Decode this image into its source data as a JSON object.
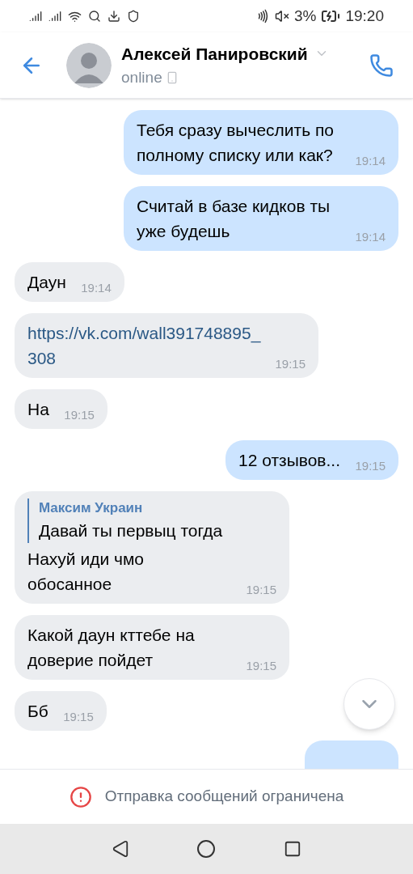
{
  "status_bar": {
    "battery": "3%",
    "time": "19:20"
  },
  "header": {
    "name": "Алексей Панировский",
    "status": "online"
  },
  "messages": [
    {
      "kind": "out",
      "text": "Тебя сразу вычеслить по полному списку или как?",
      "time": "19:14"
    },
    {
      "kind": "out",
      "text": "Считай в базе кидков ты уже будешь",
      "time": "19:14"
    },
    {
      "kind": "in",
      "text": "Даун",
      "time": "19:14"
    },
    {
      "kind": "link",
      "text": "https://vk.com/wall391748895_308",
      "time": "19:15"
    },
    {
      "kind": "in",
      "text": "На",
      "time": "19:15"
    },
    {
      "kind": "out",
      "text": "12 отзывов...",
      "time": "19:15"
    },
    {
      "kind": "reply",
      "reply_author": "Максим Украин",
      "reply_text": "Давай ты первыц тогда",
      "text": "Нахуй иди чмо обосанное",
      "time": "19:15"
    },
    {
      "kind": "in",
      "text": "Какой даун кттебе на доверие пойдет",
      "time": "19:15"
    },
    {
      "kind": "in",
      "text": "Бб",
      "time": "19:15"
    }
  ],
  "notice": "Отправка сообщений ограничена"
}
